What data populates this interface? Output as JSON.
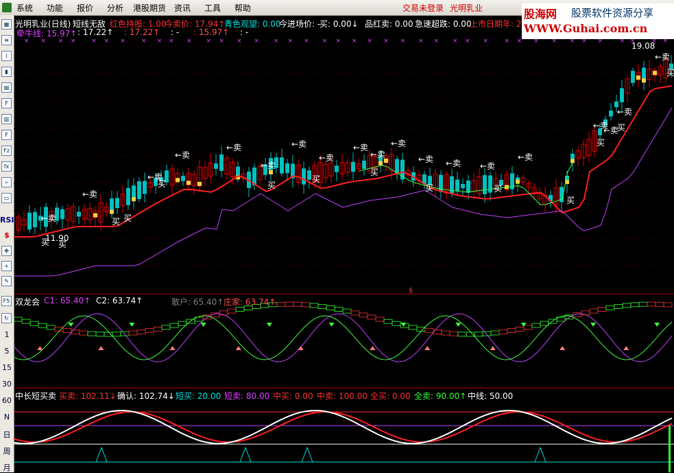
{
  "menubar": {
    "items": [
      "系统",
      "功能",
      "报价",
      "分析",
      "港股期货",
      "资讯",
      "工具",
      "帮助"
    ],
    "status_login": "交易未登录",
    "status_stock": "光明乳业"
  },
  "watermark": {
    "site_name": "股海网",
    "slogan": "股票软件资源分享",
    "url": "WWW.Guhai.com.cn"
  },
  "toolbar": {
    "icons": [
      "chart-icon",
      "list-icon",
      "line-icon",
      "candle-icon",
      "news-icon",
      "f10-icon",
      "doc-icon",
      "f-icon",
      "fiz-icon",
      "fx-icon",
      "zoom-icon",
      "bars-icon"
    ],
    "text_buttons": [
      "RSI",
      "$"
    ],
    "periods": [
      "1",
      "5",
      "15",
      "30",
      "60",
      "N",
      "日",
      "周",
      "月"
    ],
    "f5_label": "F5"
  },
  "main_panel": {
    "title": "光明乳业(日线)",
    "indicator": "短线无敌",
    "legend": [
      {
        "label": "红色持股:",
        "value": "1.00",
        "color": "#ff3030"
      },
      {
        "label": "今卖价:",
        "value": "17.94",
        "color": "#ff3030",
        "arrow": "↑"
      },
      {
        "label": "青色观望:",
        "value": "0.00",
        "color": "#00e0e0"
      },
      {
        "label": "今进场价:",
        "value": "-",
        "color": "#ffffff"
      },
      {
        "label": "买:",
        "value": "0.00",
        "color": "#ffffff",
        "arrow": "↓"
      },
      {
        "label": "品红卖:",
        "value": "0.00",
        "color": "#ffffff"
      },
      {
        "label": "急速超跌:",
        "value": "0.00",
        "color": "#ffffff"
      },
      {
        "label": "上市日期年:",
        "value": "2",
        "color": "#ff3030"
      }
    ],
    "legend_row2": [
      {
        "label": "牵牛线:",
        "value": "15.97",
        "color": "#e040ff",
        "arrow": "↑"
      },
      {
        "label": ":",
        "value": "17.22",
        "color": "#ffffff",
        "arrow": "↑"
      },
      {
        "label": ":",
        "value": "17.22",
        "color": "#ff5050",
        "arrow": "↑"
      },
      {
        "label": ":",
        "value": "-",
        "color": "#ffffff"
      },
      {
        "label": ":",
        "value": "15.97",
        "color": "#ff5050",
        "arrow": "↑"
      },
      {
        "label": ":",
        "value": "-",
        "color": "#ffffff"
      }
    ],
    "price_high_label": "19.08",
    "price_low_label": "11.90",
    "sell_label": "卖",
    "buy_label": "买",
    "sell_signals": 19,
    "buy_signals": 14
  },
  "panel2": {
    "title": "双龙会",
    "legend": [
      {
        "label": "C1:",
        "value": "65.40",
        "color": "#e040ff",
        "arrow": "↑"
      },
      {
        "label": "C2:",
        "value": "63.74",
        "color": "#ffffff",
        "arrow": "↑"
      },
      {
        "label": "散户:",
        "value": "65.40",
        "color": "#808080",
        "arrow": "↑"
      },
      {
        "label": "庄家:",
        "value": "63.74",
        "color": "#ff5050",
        "arrow": "↑"
      }
    ]
  },
  "panel3": {
    "title": "中长短买卖",
    "legend": [
      {
        "label": "买卖:",
        "value": "102.11",
        "color": "#ff3030",
        "arrow": "↓"
      },
      {
        "label": "确认:",
        "value": "102.74",
        "color": "#ffffff",
        "arrow": "↓"
      },
      {
        "label": "短买:",
        "value": "20.00",
        "color": "#00e0e0"
      },
      {
        "label": "短卖:",
        "value": "80.00",
        "color": "#e040ff"
      },
      {
        "label": "中买:",
        "value": "0.00",
        "color": "#ff3030"
      },
      {
        "label": "中卖:",
        "value": "100.00",
        "color": "#ff3030"
      },
      {
        "label": "全买:",
        "value": "0.00",
        "color": "#ff3030"
      },
      {
        "label": "全卖:",
        "value": "90.00",
        "color": "#30ff30",
        "arrow": "↑"
      },
      {
        "label": "中线:",
        "value": "50.00",
        "color": "#ffffff"
      }
    ]
  },
  "colors": {
    "up": "#e00000",
    "down": "#00c0c0",
    "ma_red": "#ff2020",
    "ma_purple": "#c040ff",
    "ma_green": "#40ff40",
    "divider": "#b00000",
    "bg": "#000000"
  }
}
